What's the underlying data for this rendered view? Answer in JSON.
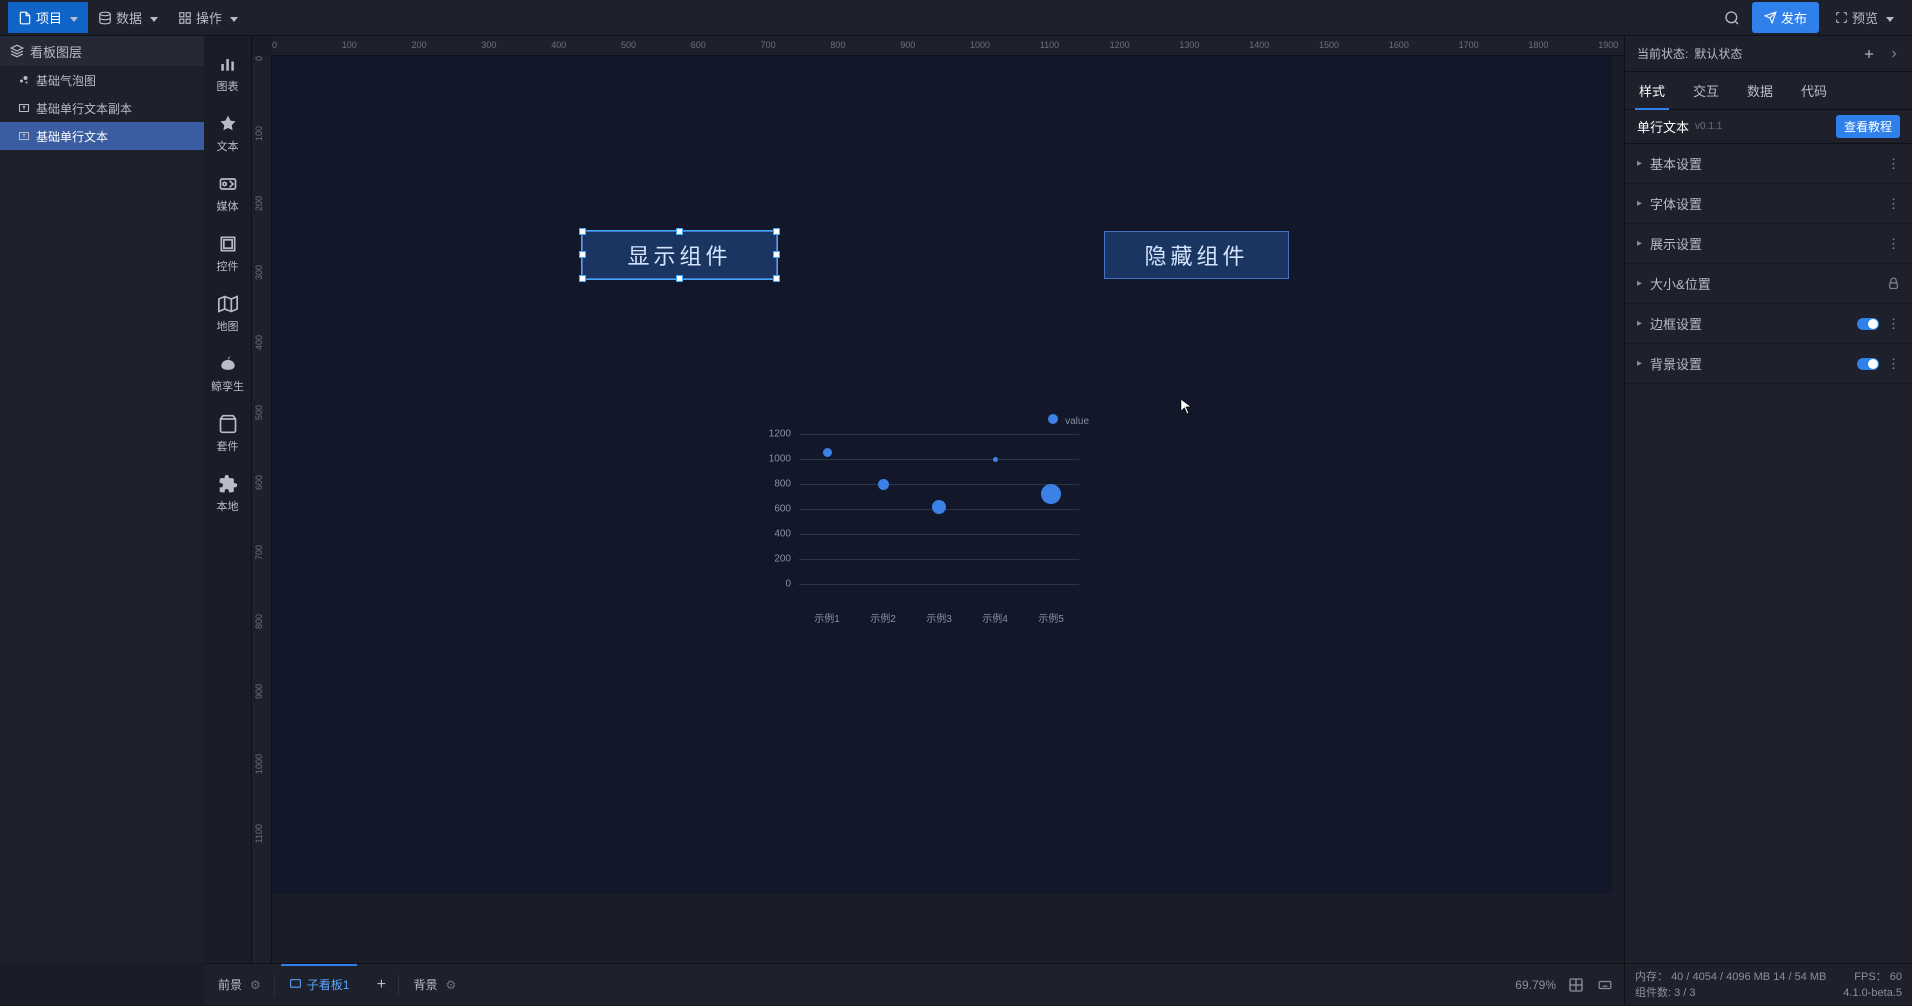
{
  "top_menu": {
    "project": "项目",
    "data": "数据",
    "operate": "操作",
    "publish": "发布",
    "preview": "预览"
  },
  "left_panel": {
    "header": "看板图层",
    "layers": [
      {
        "icon": "bubble",
        "label": "基础气泡图",
        "selected": false
      },
      {
        "icon": "text",
        "label": "基础单行文本副本",
        "selected": false
      },
      {
        "icon": "text",
        "label": "基础单行文本",
        "selected": true
      }
    ]
  },
  "comp_toolbar": [
    {
      "icon": "chart",
      "label": "图表"
    },
    {
      "icon": "text",
      "label": "文本"
    },
    {
      "icon": "media",
      "label": "媒体"
    },
    {
      "icon": "control",
      "label": "控件"
    },
    {
      "icon": "map",
      "label": "地图"
    },
    {
      "icon": "whale",
      "label": "鲸孪生"
    },
    {
      "icon": "suite",
      "label": "套件"
    },
    {
      "icon": "local",
      "label": "本地"
    }
  ],
  "canvas": {
    "widget_show": "显示组件",
    "widget_hide": "隐藏组件"
  },
  "chart_data": {
    "type": "bubble",
    "legend": "value",
    "y_ticks": [
      0,
      200,
      400,
      600,
      800,
      1000,
      1200
    ],
    "categories": [
      "示例1",
      "示例2",
      "示例3",
      "示例4",
      "示例5"
    ],
    "points": [
      {
        "x": "示例1",
        "y": 1050,
        "size": 9
      },
      {
        "x": "示例2",
        "y": 800,
        "size": 11
      },
      {
        "x": "示例3",
        "y": 620,
        "size": 14
      },
      {
        "x": "示例4",
        "y": 1000,
        "size": 5
      },
      {
        "x": "示例5",
        "y": 720,
        "size": 20
      }
    ],
    "ylim": [
      0,
      1200
    ]
  },
  "right_panel": {
    "state_label": "当前状态:",
    "state_value": "默认状态",
    "tabs": [
      "样式",
      "交互",
      "数据",
      "代码"
    ],
    "comp_name": "单行文本",
    "comp_version": "v0.1.1",
    "tutorial": "查看教程",
    "groups": [
      {
        "label": "基本设置",
        "ctrl": "dots"
      },
      {
        "label": "字体设置",
        "ctrl": "dots"
      },
      {
        "label": "展示设置",
        "ctrl": "dots"
      },
      {
        "label": "大小&位置",
        "ctrl": "lock"
      },
      {
        "label": "边框设置",
        "ctrl": "toggle-dots"
      },
      {
        "label": "背景设置",
        "ctrl": "toggle-dots"
      }
    ]
  },
  "bottom_bar": {
    "foreground": "前景",
    "subboard": "子看板1",
    "background": "背景",
    "zoom": "69.79%"
  },
  "status": {
    "memory_label": "内存：",
    "memory_value": "40 / 4054 / 4096 MB  14 / 54 MB",
    "fps_label": "FPS：",
    "fps_value": "60",
    "comp_count_label": "组件数: ",
    "comp_count_value": "3 / 3",
    "version": "4.1.0-beta.5"
  }
}
